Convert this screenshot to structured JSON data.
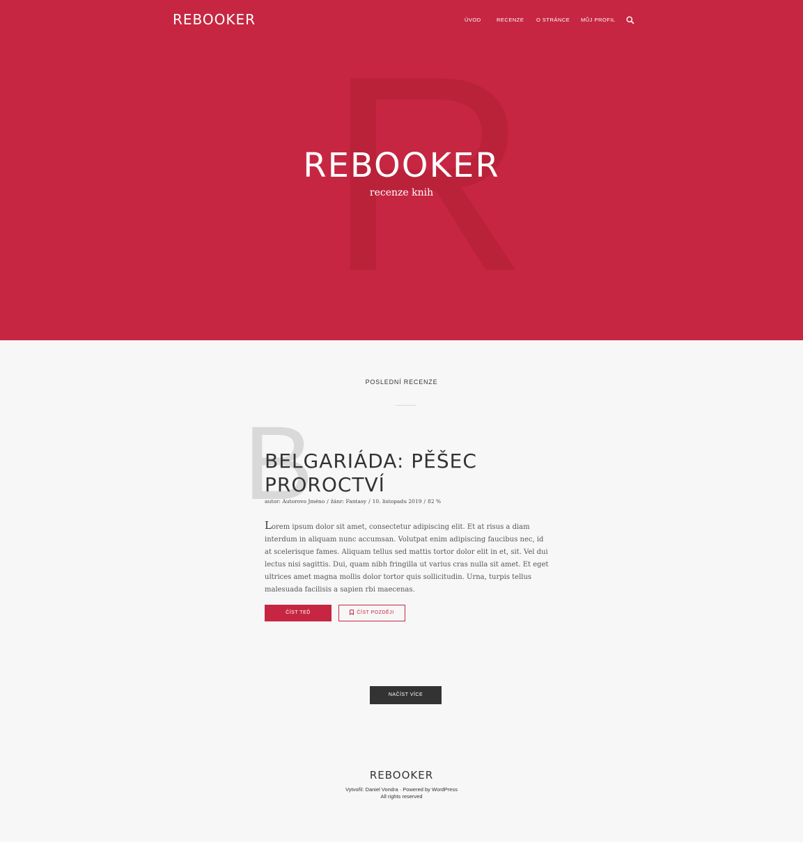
{
  "header": {
    "logo": "REBOOKER",
    "nav": [
      {
        "label": "Úvod"
      },
      {
        "label": "Recenze"
      },
      {
        "label": "O stránce"
      },
      {
        "label": "Můj profil"
      }
    ],
    "search_icon": "search-icon"
  },
  "hero": {
    "bg_letter": "R",
    "title": "REBOOKER",
    "subtitle": "recenze knih"
  },
  "main": {
    "section_title": "Poslední recenze",
    "article": {
      "bg_letter": "B",
      "title": "Belgariáda: Pěšec proroctví",
      "meta": {
        "author": "autor: Autorovo Jméno",
        "genre": "žánr: Fantasy",
        "date": "10. listopadu 2019",
        "rating": "82 %"
      },
      "excerpt_first": "L",
      "excerpt_rest": "orem ipsum dolor sit amet, consectetur adipiscing elit. Et at risus a diam interdum in aliquam nunc accumsan. Volutpat enim adipiscing faucibus nec, id at scelerisque fames. Aliquam tellus sed mattis tortor dolor elit in et, sit. Vel dui lectus nisi sagittis. Dui, quam nibh fringilla ut varius cras nulla sit amet. Et eget ultrices amet magna mollis dolor tortor quis sollicitudin. Urna, turpis tellus malesuada facilisis a sapien rbi maecenas.",
      "read_now": "Číst teď",
      "read_later": "Číst později",
      "read_later_icon": "bookmark-icon"
    },
    "load_more": "Načíst více"
  },
  "footer": {
    "logo": "REBOOKER",
    "credit": "Vytvořil: Daniel Vondra · Powered by WordPress",
    "rights": "All rights reserved"
  },
  "colors": {
    "accent": "#c62641",
    "dark": "#333333",
    "background": "#f7f7f7"
  }
}
